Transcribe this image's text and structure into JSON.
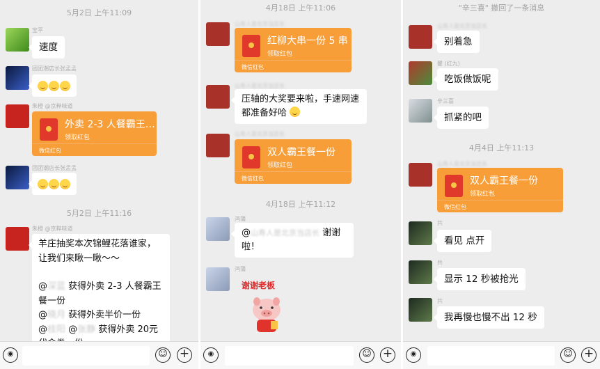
{
  "panel0": {
    "times": [
      "5月2日 上午11:09",
      "5月2日 上午11:16"
    ],
    "senders": [
      "宝平",
      "团团潮店长张孟孟",
      "朱橙 @京粹味道",
      "团团潮店长张孟孟",
      "朱橙 @京粹味道"
    ],
    "msg1": "速度",
    "packet": {
      "title": "外卖 2-3 人餐霸王…",
      "sub": "领取红包",
      "foot": "微信红包"
    },
    "lottery_lines": [
      "羊庄抽奖本次锦鲤花落谁家，",
      "让我们来瞅一瞅～～"
    ],
    "winners": [
      {
        "at": "@",
        "name": "深蓝",
        "text": "获得外卖 2-3 人餐霸王"
      },
      {
        "cont": "餐一份"
      },
      {
        "at": "@",
        "name": "晓月",
        "text": "获得外卖半价一份"
      },
      {
        "at": "@",
        "name": "桂阳",
        "at2": "@",
        "name2": "张静",
        "text": "获得外卖 20元"
      },
      {
        "cont": "代金券一份"
      }
    ]
  },
  "panel1": {
    "times": [
      "4月18日 上午11:06",
      "4月18日 上午11:12"
    ],
    "senders": [
      "山寿人是北京当店长",
      "山寿人是北京当店长",
      "山寿人是北京当店长",
      "鸿蒲",
      "鸿蒲"
    ],
    "packet1": {
      "title": "红柳大串一份 5 串",
      "sub": "领取红包",
      "foot": "微信红包"
    },
    "msg1_lines": [
      "压轴的大奖要来啦，手速网速",
      "都准备好哈"
    ],
    "packet2": {
      "title": "双人霸王餐一份",
      "sub": "领取红包",
      "foot": "微信红包"
    },
    "reply": {
      "at": "@",
      "name": "山寿人是北京当店长",
      "suffix": "谢谢",
      "line2": "啦！"
    },
    "sticker_text": "谢谢老板"
  },
  "panel2": {
    "recall_notice": "\"辛三喜\" 撤回了一条消息",
    "time": "4月4日 上午11:13",
    "senders": [
      "山寿人是北京当店长",
      "馨 (红九)",
      "辛三喜",
      "山寿人是北京当店长",
      "共",
      "共",
      "共"
    ],
    "msgs": [
      "别着急",
      "吃饭做饭呢",
      "抓紧的吧"
    ],
    "packet": {
      "title": "双人霸王餐一份",
      "sub": "领取红包",
      "foot": "微信红包"
    },
    "replies": [
      "看见 点开",
      "显示 12 秒被抢光",
      "我再慢也慢不出 12 秒"
    ]
  },
  "toolbar": {
    "voice_icon": "voice-icon",
    "emoji_icon": "emoji-icon",
    "plus_icon": "plus-icon"
  }
}
